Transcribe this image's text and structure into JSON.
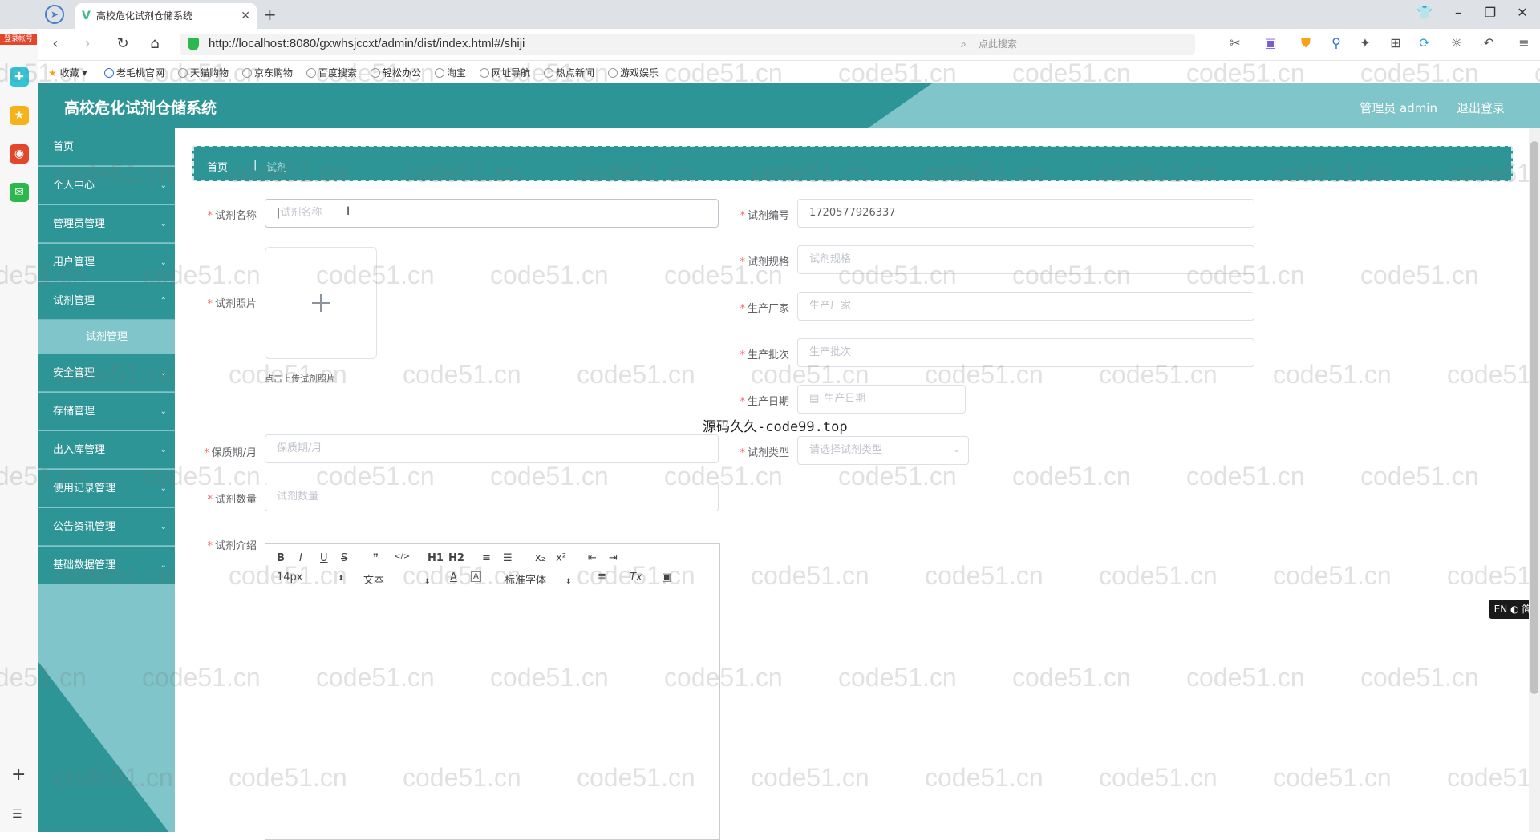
{
  "browser": {
    "tab_title": "高校危化试剂仓储系统",
    "url": "http://localhost:8080/gxwhsjccxt/admin/dist/index.html#/shiji",
    "search_placeholder": "点此搜索",
    "login_badge": "登录帐号",
    "bookmarks": [
      "收藏",
      "老毛桃官网",
      "天猫购物",
      "京东购物",
      "百度搜索",
      "轻松办公",
      "淘宝",
      "网址导航",
      "热点新闻",
      "游戏娱乐"
    ]
  },
  "header": {
    "title": "高校危化试剂仓储系统",
    "admin_label": "管理员 admin",
    "logout_label": "退出登录"
  },
  "sidebar": {
    "items": [
      {
        "label": "首页"
      },
      {
        "label": "个人中心"
      },
      {
        "label": "管理员管理"
      },
      {
        "label": "用户管理"
      },
      {
        "label": "试剂管理"
      },
      {
        "label": "安全管理"
      },
      {
        "label": "存储管理"
      },
      {
        "label": "出入库管理"
      },
      {
        "label": "使用记录管理"
      },
      {
        "label": "公告资讯管理"
      },
      {
        "label": "基础数据管理"
      }
    ],
    "sub_item": "试剂管理"
  },
  "breadcrumb": {
    "home": "首页",
    "separator": "|",
    "current": "试剂"
  },
  "form": {
    "name": {
      "label": "试剂名称",
      "placeholder": "试剂名称"
    },
    "code": {
      "label": "试剂编号",
      "value": "1720577926337"
    },
    "spec": {
      "label": "试剂规格",
      "placeholder": "试剂规格"
    },
    "photo": {
      "label": "试剂照片",
      "hint": "点击上传试剂照片"
    },
    "maker": {
      "label": "生产厂家",
      "placeholder": "生产厂家"
    },
    "batch": {
      "label": "生产批次",
      "placeholder": "生产批次"
    },
    "date": {
      "label": "生产日期",
      "placeholder": "生产日期"
    },
    "shelf": {
      "label": "保质期/月",
      "placeholder": "保质期/月"
    },
    "type": {
      "label": "试剂类型",
      "placeholder": "请选择试剂类型"
    },
    "qty": {
      "label": "试剂数量",
      "placeholder": "试剂数量"
    },
    "intro": {
      "label": "试剂介绍"
    }
  },
  "editor": {
    "font_size": "14px",
    "block": "文本",
    "font_family": "标准字体",
    "buttons": [
      "B",
      "I",
      "U",
      "S",
      "❞",
      "</>",
      "H1",
      "H2",
      "≡",
      "☰",
      "x₂",
      "x²",
      "⇤",
      "⇥",
      "A",
      "A",
      "≣",
      "Tx",
      "▣"
    ]
  },
  "overlay": {
    "center_text": "源码久久-code99.top",
    "watermark": "code51.cn",
    "lang_badge": "EN ◐ 简"
  },
  "colors": {
    "primary": "#2e9597",
    "light": "#7fc5c9",
    "required": "#f56c6c"
  }
}
